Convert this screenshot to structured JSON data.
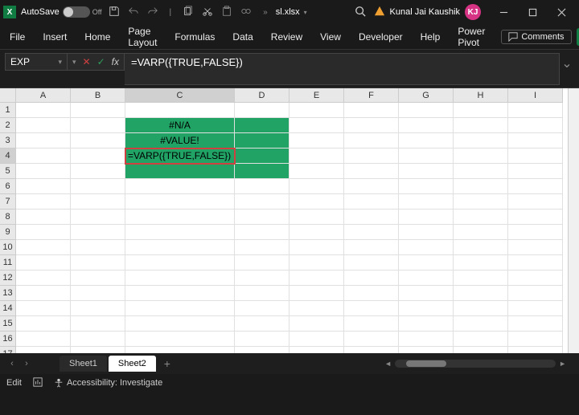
{
  "titlebar": {
    "autosave_label": "AutoSave",
    "autosave_state": "Off",
    "filename": "sl.xlsx",
    "user_name": "Kunal Jai Kaushik",
    "user_initials": "KJ"
  },
  "ribbon": {
    "tabs": [
      "File",
      "Insert",
      "Home",
      "Page Layout",
      "Formulas",
      "Data",
      "Review",
      "View",
      "Developer",
      "Help",
      "Power Pivot"
    ],
    "comments_label": "Comments"
  },
  "formula_bar": {
    "name_box": "EXP",
    "formula": "=VARP({TRUE,FALSE})"
  },
  "grid": {
    "columns": [
      "A",
      "B",
      "C",
      "D",
      "E",
      "F",
      "G",
      "H",
      "I"
    ],
    "rows": [
      "1",
      "2",
      "3",
      "4",
      "5",
      "6",
      "7",
      "8",
      "9",
      "10",
      "11",
      "12",
      "13",
      "14",
      "15",
      "16",
      "17"
    ],
    "active_col_index": 2,
    "active_row_index": 3,
    "cells": {
      "C2": "#N/A",
      "C3": "#VALUE!",
      "C4": "=VARP({TRUE,FALSE})"
    }
  },
  "sheets": {
    "items": [
      "Sheet1",
      "Sheet2"
    ],
    "active_index": 1
  },
  "statusbar": {
    "mode": "Edit",
    "accessibility": "Accessibility: Investigate"
  }
}
